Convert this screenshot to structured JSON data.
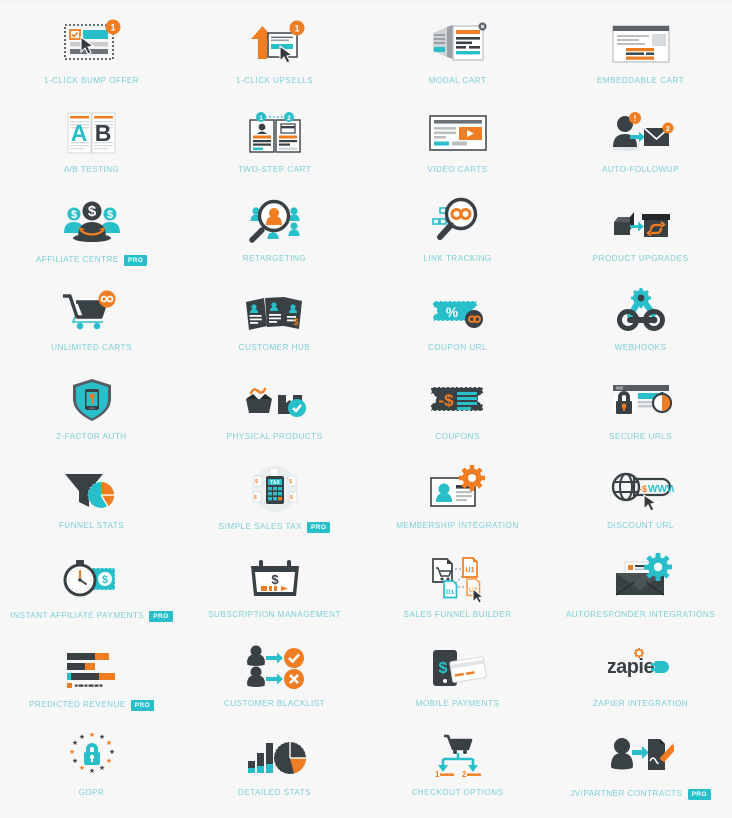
{
  "page": {
    "title": "Feature Overview Grid",
    "background_color": "#f7f7f7",
    "label_color": "#7ecfd6",
    "accent_teal": "#29bfca",
    "accent_orange": "#f07d22",
    "dark": "#3a4145",
    "columns": 4,
    "rows": 10
  },
  "badge": {
    "pro_label": "PRO"
  },
  "features": [
    {
      "label": "1-CLICK BUMP OFFER",
      "icon": "bump-offer-icon",
      "pro": false
    },
    {
      "label": "1-CLICK UPSELLS",
      "icon": "upsell-arrow-icon",
      "pro": false
    },
    {
      "label": "MODAL CART",
      "icon": "modal-cart-icon",
      "pro": false
    },
    {
      "label": "EMBEDDABLE CART",
      "icon": "embeddable-cart-icon",
      "pro": false
    },
    {
      "label": "A/B TESTING",
      "icon": "ab-testing-icon",
      "pro": false
    },
    {
      "label": "TWO-STEP CART",
      "icon": "two-step-cart-icon",
      "pro": false
    },
    {
      "label": "VIDEO CARTS",
      "icon": "video-cart-icon",
      "pro": false
    },
    {
      "label": "AUTO-FOLLOWUP",
      "icon": "auto-followup-icon",
      "pro": false
    },
    {
      "label": "AFFILIATE CENTRE",
      "icon": "affiliate-centre-icon",
      "pro": true
    },
    {
      "label": "RETARGETING",
      "icon": "retargeting-icon",
      "pro": false
    },
    {
      "label": "LINK TRACKING",
      "icon": "link-tracking-icon",
      "pro": false
    },
    {
      "label": "PRODUCT UPGRADES",
      "icon": "product-upgrades-icon",
      "pro": false
    },
    {
      "label": "UNLIMITED CARTS",
      "icon": "unlimited-carts-icon",
      "pro": false
    },
    {
      "label": "CUSTOMER HUB",
      "icon": "customer-hub-icon",
      "pro": false
    },
    {
      "label": "COUPON URL",
      "icon": "coupon-url-icon",
      "pro": false
    },
    {
      "label": "WEBHOOKS",
      "icon": "webhooks-icon",
      "pro": false
    },
    {
      "label": "2-FACTOR AUTH",
      "icon": "two-factor-auth-icon",
      "pro": false
    },
    {
      "label": "PHYSICAL PRODUCTS",
      "icon": "physical-products-icon",
      "pro": false
    },
    {
      "label": "COUPONS",
      "icon": "coupons-icon",
      "pro": false
    },
    {
      "label": "SECURE URLS",
      "icon": "secure-urls-icon",
      "pro": false
    },
    {
      "label": "FUNNEL STATS",
      "icon": "funnel-stats-icon",
      "pro": false
    },
    {
      "label": "SIMPLE SALES TAX",
      "icon": "sales-tax-icon",
      "pro": true
    },
    {
      "label": "MEMBERSHIP INTEGRATION",
      "icon": "membership-integration-icon",
      "pro": false
    },
    {
      "label": "DISCOUNT URL",
      "icon": "discount-url-icon",
      "pro": false
    },
    {
      "label": "INSTANT AFFILIATE PAYMENTS",
      "icon": "instant-affiliate-payments-icon",
      "pro": true
    },
    {
      "label": "SUBSCRIPTION MANAGEMENT",
      "icon": "subscription-management-icon",
      "pro": false
    },
    {
      "label": "SALES FUNNEL BUILDER",
      "icon": "sales-funnel-builder-icon",
      "pro": false
    },
    {
      "label": "AUTORESPONDER INTEGRATIONS",
      "icon": "autoresponder-integrations-icon",
      "pro": false
    },
    {
      "label": "PREDICTED REVENUE",
      "icon": "predicted-revenue-icon",
      "pro": true
    },
    {
      "label": "CUSTOMER BLACKLIST",
      "icon": "customer-blacklist-icon",
      "pro": false
    },
    {
      "label": "MOBILE PAYMENTS",
      "icon": "mobile-payments-icon",
      "pro": false
    },
    {
      "label": "ZAPIER INTEGRATION",
      "icon": "zapier-integration-icon",
      "pro": false
    },
    {
      "label": "GDPR",
      "icon": "gdpr-icon",
      "pro": false
    },
    {
      "label": "DETAILED STATS",
      "icon": "detailed-stats-icon",
      "pro": false
    },
    {
      "label": "CHECKOUT OPTIONS",
      "icon": "checkout-options-icon",
      "pro": false
    },
    {
      "label": "JV/PARTNER CONTRACTS",
      "icon": "jv-partner-contracts-icon",
      "pro": true
    }
  ]
}
